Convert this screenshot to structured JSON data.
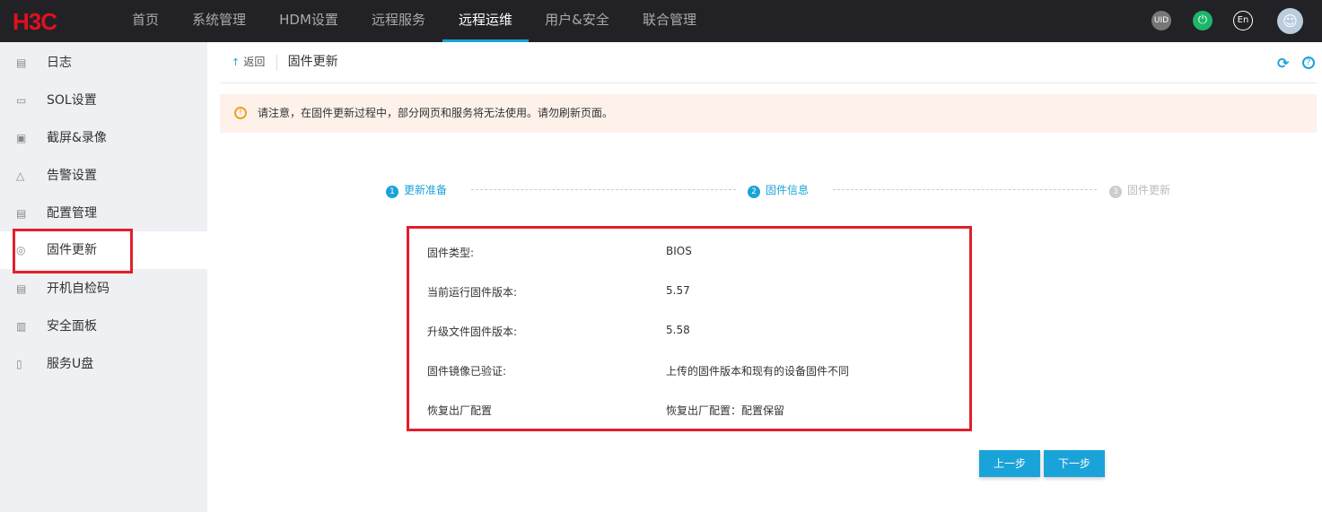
{
  "header": {
    "logo": "H3C",
    "nav": [
      "首页",
      "系统管理",
      "HDM设置",
      "远程服务",
      "远程运维",
      "用户&安全",
      "联合管理"
    ],
    "active": "远程运维",
    "icons": {
      "uid": "UID",
      "lang": "En"
    }
  },
  "sidebar": {
    "items": [
      {
        "label": "日志",
        "icon": "▤"
      },
      {
        "label": "SOL设置",
        "icon": "▭"
      },
      {
        "label": "截屏&录像",
        "icon": "▣"
      },
      {
        "label": "告警设置",
        "icon": "△"
      },
      {
        "label": "配置管理",
        "icon": "▤"
      },
      {
        "label": "固件更新",
        "icon": "◎"
      },
      {
        "label": "开机自检码",
        "icon": "▤"
      },
      {
        "label": "安全面板",
        "icon": "▥"
      },
      {
        "label": "服务U盘",
        "icon": "▯"
      }
    ],
    "active": "固件更新"
  },
  "breadcrumb": {
    "back": "返回",
    "title": "固件更新"
  },
  "alert": "请注意，在固件更新过程中，部分网页和服务将无法使用。请勿刷新页面。",
  "steps": [
    {
      "n": "1",
      "label": "更新准备"
    },
    {
      "n": "2",
      "label": "固件信息"
    },
    {
      "n": "3",
      "label": "固件更新"
    }
  ],
  "info": [
    {
      "k": "固件类型:",
      "v": "BIOS"
    },
    {
      "k": "当前运行固件版本:",
      "v": "5.57"
    },
    {
      "k": "升级文件固件版本:",
      "v": "5.58"
    },
    {
      "k": "固件镜像已验证:",
      "v": "上传的固件版本和现有的设备固件不同"
    },
    {
      "k": "恢复出厂配置",
      "v": "恢复出厂配置：配置保留"
    }
  ],
  "buttons": {
    "prev": "上一步",
    "next": "下一步"
  },
  "colors": {
    "accent": "#1aa3d9",
    "highlight": "#e0202a"
  }
}
